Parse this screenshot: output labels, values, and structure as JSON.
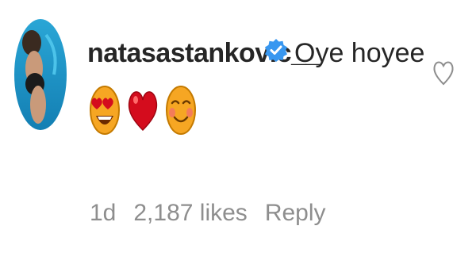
{
  "comment": {
    "username": "natasastankovic__",
    "verified": true,
    "text": "Oye hoyee",
    "emojis": [
      "heart-eyes-emoji",
      "red-heart-emoji",
      "smiling-face-emoji"
    ],
    "time": "1d",
    "likes": "2,187 likes",
    "reply_label": "Reply"
  },
  "colors": {
    "text": "#262626",
    "meta": "#8e8e8e",
    "verified_badge": "#3897f0",
    "heart": "#d40c1d"
  },
  "icons": {
    "like": "heart-outline-icon",
    "verified": "verified-badge-icon"
  }
}
